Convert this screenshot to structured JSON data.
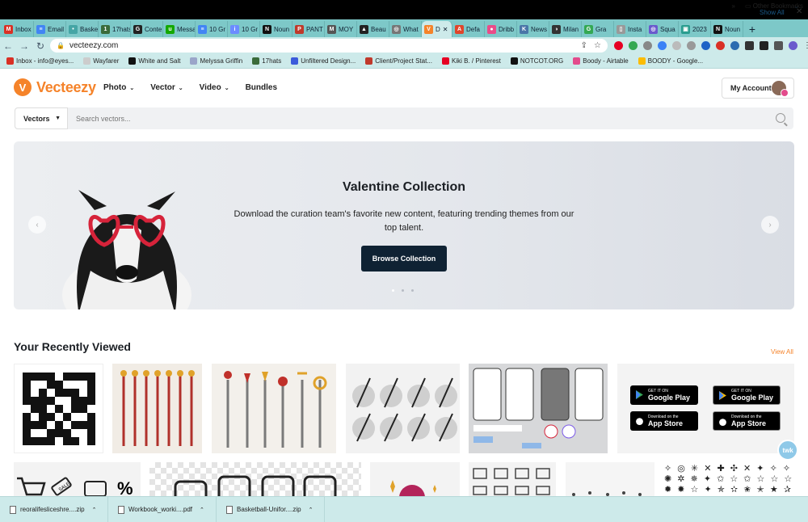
{
  "browser": {
    "tabs": [
      {
        "label": "Inbox",
        "color": "#d93025",
        "glyph": "M"
      },
      {
        "label": "Email",
        "color": "#4285f4",
        "glyph": "≡"
      },
      {
        "label": "Baske",
        "color": "#45a5a5",
        "glyph": "•"
      },
      {
        "label": "17hats",
        "color": "#3a6b3a",
        "glyph": "1"
      },
      {
        "label": "Conte",
        "color": "#222222",
        "glyph": "G"
      },
      {
        "label": "Messa",
        "color": "#14a800",
        "glyph": "u"
      },
      {
        "label": "10 Gr",
        "color": "#4285f4",
        "glyph": "≡"
      },
      {
        "label": "10 Gr",
        "color": "#6c8cff",
        "glyph": "i"
      },
      {
        "label": "Noun",
        "color": "#111111",
        "glyph": "N"
      },
      {
        "label": "PANT",
        "color": "#c0392b",
        "glyph": "P"
      },
      {
        "label": "MOY",
        "color": "#555555",
        "glyph": "M"
      },
      {
        "label": "Beau",
        "color": "#222222",
        "glyph": "▲"
      },
      {
        "label": "What",
        "color": "#777777",
        "glyph": "◎"
      },
      {
        "label": "D",
        "color": "#f5832a",
        "glyph": "V",
        "active": true
      },
      {
        "label": "Defa",
        "color": "#e0452b",
        "glyph": "A"
      },
      {
        "label": "Dribb",
        "color": "#ea4c89",
        "glyph": "●"
      },
      {
        "label": "News",
        "color": "#4a76a8",
        "glyph": "K"
      },
      {
        "label": "Milan",
        "color": "#333333",
        "glyph": "◑"
      },
      {
        "label": "Gra",
        "color": "#34a853",
        "glyph": "G"
      },
      {
        "label": "Insta",
        "color": "#999999",
        "glyph": "▯"
      },
      {
        "label": "Squa",
        "color": "#6a5acd",
        "glyph": "◎"
      },
      {
        "label": "2023",
        "color": "#2a9d8f",
        "glyph": "▣"
      },
      {
        "label": "Noun",
        "color": "#111111",
        "glyph": "N"
      }
    ],
    "new_tab": "+",
    "url": "vecteezy.com",
    "bookmarks": [
      {
        "label": "Inbox - info@eyes...",
        "color": "#d93025"
      },
      {
        "label": "Wayfarer",
        "color": "#cccccc"
      },
      {
        "label": "White and Salt",
        "color": "#111111"
      },
      {
        "label": "Melyssa Griffin",
        "color": "#9aa5c9"
      },
      {
        "label": "17hats",
        "color": "#3a6b3a"
      },
      {
        "label": "Unfiltered Design...",
        "color": "#3b5bdb"
      },
      {
        "label": "Client/Project Stat...",
        "color": "#c0392b"
      },
      {
        "label": "Kiki B. / Pinterest",
        "color": "#e60023"
      },
      {
        "label": "NOTCOT.ORG",
        "color": "#111111"
      },
      {
        "label": "Boody - Airtable",
        "color": "#e34b8c"
      },
      {
        "label": "BOODY - Google...",
        "color": "#fbbc04"
      }
    ],
    "bookmarks_more": "»",
    "other_bookmarks": "Other Bookmarks"
  },
  "site": {
    "logo_text": "Vecteezy",
    "nav": [
      {
        "label": "Photo",
        "dropdown": true
      },
      {
        "label": "Vector",
        "dropdown": true
      },
      {
        "label": "Video",
        "dropdown": true
      },
      {
        "label": "Bundles",
        "dropdown": false
      }
    ],
    "account_label": "My Account"
  },
  "search": {
    "scope": "Vectors",
    "placeholder": "Search vectors..."
  },
  "hero": {
    "title": "Valentine Collection",
    "description": "Download the curation team's favorite new content, featuring trending themes from our top talent.",
    "cta": "Browse Collection",
    "slide_count": 3,
    "active_slide": 1
  },
  "recent": {
    "title": "Your Recently Viewed",
    "view_all": "View All",
    "badges": {
      "google_small": "GET IT ON",
      "google_big": "Google Play",
      "apple_small": "Download on the",
      "apple_big": "App Store"
    },
    "tag_text": "SALE",
    "percent_text": "%",
    "stars_text": "✧ ◎ ✳ ✕ ✚ ✣ ✕ ✦ ✧ ✧ ✺ ✲ ✵ ✦ ✩ ☆ ✩ ☆ ☆ ☆ ✹ ✸ ☆ ✦ ✯ ✫ ✬ ✭ ★ ✰"
  },
  "chat_label": "twk",
  "downloads": {
    "items": [
      {
        "label": "reoralifesliceshre....zip"
      },
      {
        "label": "Workbook_worki....pdf"
      },
      {
        "label": "Basketball-Unifor....zip"
      }
    ],
    "show_all": "Show All",
    "close": "✕"
  }
}
